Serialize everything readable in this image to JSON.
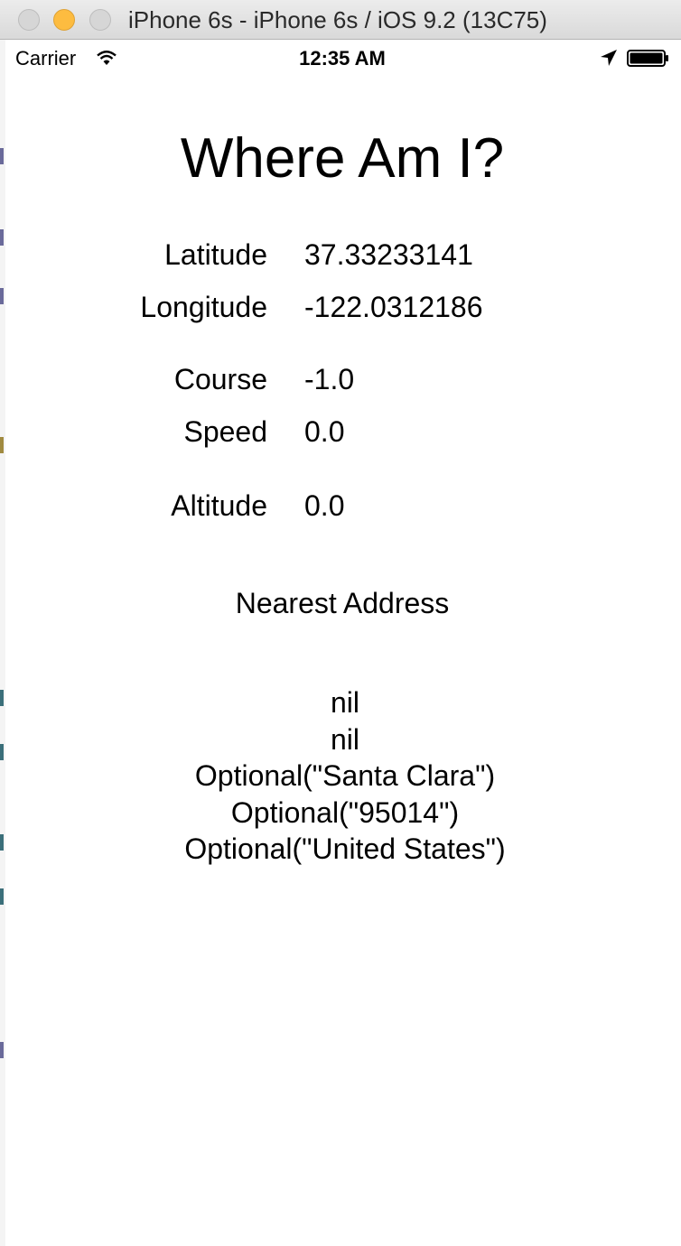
{
  "window": {
    "title": "iPhone 6s - iPhone 6s / iOS 9.2 (13C75)"
  },
  "statusbar": {
    "carrier": "Carrier",
    "time": "12:35 AM"
  },
  "app": {
    "title": "Where Am I?",
    "rows": [
      {
        "label": "Latitude",
        "value": "37.33233141"
      },
      {
        "label": "Longitude",
        "value": "-122.0312186"
      },
      {
        "label": "Course",
        "value": "-1.0"
      },
      {
        "label": "Speed",
        "value": "0.0"
      },
      {
        "label": "Altitude",
        "value": "0.0"
      }
    ],
    "address_heading": "Nearest Address",
    "address_lines": [
      "nil",
      "nil",
      "Optional(\"Santa Clara\")",
      "Optional(\"95014\")",
      "Optional(\"United States\")"
    ]
  }
}
